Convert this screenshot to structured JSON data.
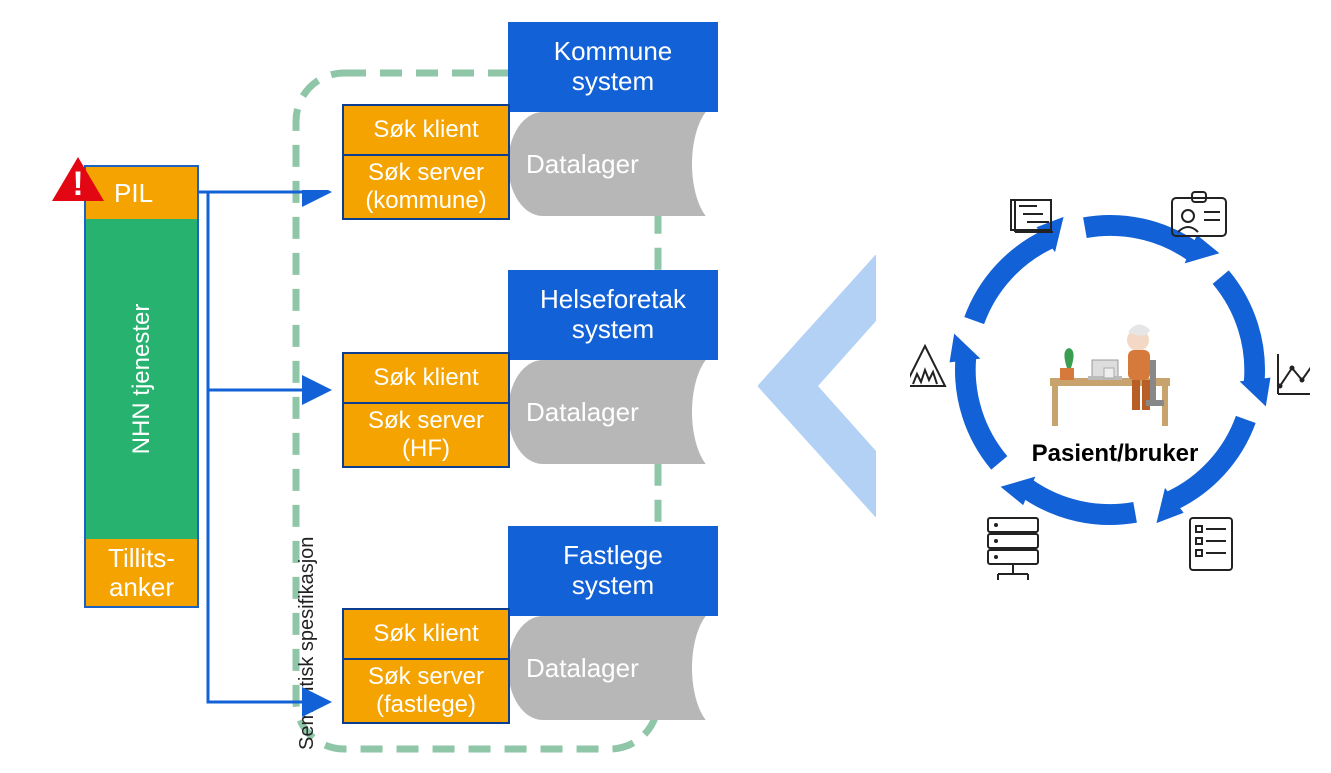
{
  "nhn": {
    "pil": "PIL",
    "mid": "NHN tjenester",
    "tillit_line1": "Tillits-",
    "tillit_line2": "anker"
  },
  "systems": [
    {
      "head_line1": "Kommune",
      "head_line2": "system",
      "klient": "Søk klient",
      "server_line1": "Søk server",
      "server_line2": "(kommune)",
      "datalager": "Datalager"
    },
    {
      "head_line1": "Helseforetak",
      "head_line2": "system",
      "klient": "Søk klient",
      "server_line1": "Søk server",
      "server_line2": "(HF)",
      "datalager": "Datalager"
    },
    {
      "head_line1": "Fastlege",
      "head_line2": "system",
      "klient": "Søk klient",
      "server_line1": "Søk server",
      "server_line2": "(fastlege)",
      "datalager": "Datalager"
    }
  ],
  "semantic_label": "Semantisk spesifikasjon",
  "patient_label": "Pasient/bruker"
}
